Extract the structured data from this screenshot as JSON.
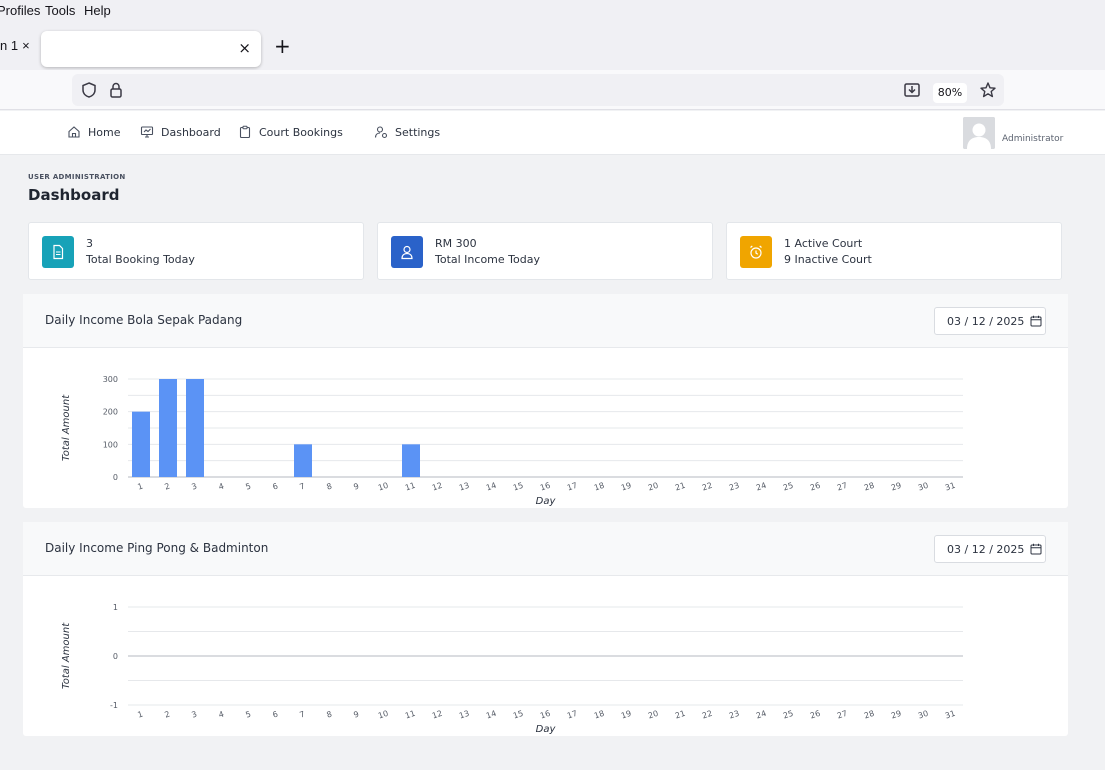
{
  "browser": {
    "menu": [
      "Profiles",
      "Tools",
      "Help"
    ],
    "prev_tab_label": "n 1",
    "prev_tab_close": "×",
    "active_tab_close": "×",
    "new_tab": "+",
    "zoom": "80%"
  },
  "header": {
    "nav": [
      {
        "label": "Home",
        "icon": "home-icon"
      },
      {
        "label": "Dashboard",
        "icon": "monitor-icon"
      },
      {
        "label": "Court Bookings",
        "icon": "clipboard-icon"
      },
      {
        "label": "Settings",
        "icon": "user-gear-icon"
      }
    ],
    "user_role": "Administrator"
  },
  "page": {
    "breadcrumb": "USER ADMINISTRATION",
    "title": "Dashboard"
  },
  "stats": [
    {
      "line1": "3",
      "line2": "Total Booking Today",
      "icon": "document-icon",
      "color": "#17a2b8"
    },
    {
      "line1": "RM 300",
      "line2": "Total Income Today",
      "icon": "user-icon",
      "color": "#2a62c9"
    },
    {
      "line1": "1 Active Court",
      "line2": "9 Inactive Court",
      "icon": "alarm-clock-icon",
      "color": "#f0a500"
    }
  ],
  "charts": [
    {
      "title": "Daily Income Bola Sepak Padang",
      "date": "03 / 12 / 2025"
    },
    {
      "title": "Daily Income Ping Pong & Badminton",
      "date": "03 / 12 / 2025"
    }
  ],
  "chart_data": [
    {
      "type": "bar",
      "xlabel": "Day",
      "ylabel": "Total Amount",
      "ylim": [
        0,
        300
      ],
      "yticks": [
        0,
        100,
        200,
        300
      ],
      "categories": [
        "1",
        "2",
        "3",
        "4",
        "5",
        "6",
        "7",
        "8",
        "9",
        "10",
        "11",
        "12",
        "13",
        "14",
        "15",
        "16",
        "17",
        "18",
        "19",
        "20",
        "21",
        "22",
        "23",
        "24",
        "25",
        "26",
        "27",
        "28",
        "29",
        "30",
        "31"
      ],
      "values": [
        200,
        300,
        300,
        0,
        0,
        0,
        100,
        0,
        0,
        0,
        100,
        0,
        0,
        0,
        0,
        0,
        0,
        0,
        0,
        0,
        0,
        0,
        0,
        0,
        0,
        0,
        0,
        0,
        0,
        0,
        0
      ],
      "color": "#5b93f5",
      "grid": true
    },
    {
      "type": "bar",
      "xlabel": "Day",
      "ylabel": "Total Amount",
      "ylim": [
        -1,
        1
      ],
      "yticks": [
        -1,
        0,
        1
      ],
      "categories": [
        "1",
        "2",
        "3",
        "4",
        "5",
        "6",
        "7",
        "8",
        "9",
        "10",
        "11",
        "12",
        "13",
        "14",
        "15",
        "16",
        "17",
        "18",
        "19",
        "20",
        "21",
        "22",
        "23",
        "24",
        "25",
        "26",
        "27",
        "28",
        "29",
        "30",
        "31"
      ],
      "values": [
        0,
        0,
        0,
        0,
        0,
        0,
        0,
        0,
        0,
        0,
        0,
        0,
        0,
        0,
        0,
        0,
        0,
        0,
        0,
        0,
        0,
        0,
        0,
        0,
        0,
        0,
        0,
        0,
        0,
        0,
        0
      ],
      "color": "#5b93f5",
      "grid": true
    }
  ]
}
